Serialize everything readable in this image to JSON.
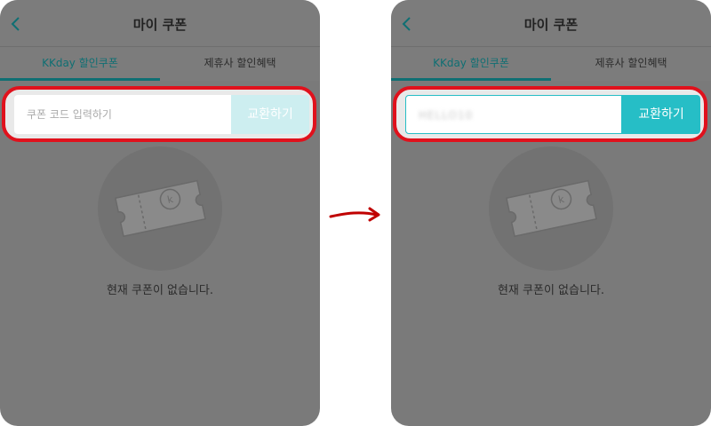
{
  "screens": [
    {
      "header": {
        "title": "마이 쿠폰"
      },
      "tabs": [
        {
          "label": "KKday 할인쿠폰"
        },
        {
          "label": "제휴사 할인혜택"
        }
      ],
      "coupon_input": {
        "placeholder": "쿠폰 코드 입력하기",
        "value": ""
      },
      "redeem_button": {
        "label": "교환하기",
        "state": "disabled"
      },
      "empty_state": {
        "message": "현재 쿠폰이 없습니다."
      }
    },
    {
      "header": {
        "title": "마이 쿠폰"
      },
      "tabs": [
        {
          "label": "KKday 할인쿠폰"
        },
        {
          "label": "제휴사 할인혜택"
        }
      ],
      "coupon_input": {
        "placeholder": "",
        "value": "HELLO10"
      },
      "redeem_button": {
        "label": "교환하기",
        "state": "active"
      },
      "empty_state": {
        "message": "현재 쿠폰이 없습니다."
      }
    }
  ],
  "colors": {
    "accent": "#26bec6",
    "highlight": "#e0111c",
    "arrow": "#c00000",
    "overlay": "#7a7a7a"
  },
  "icons": [
    "back-chevron-icon",
    "coupon-ticket-icon",
    "transition-arrow-icon"
  ]
}
